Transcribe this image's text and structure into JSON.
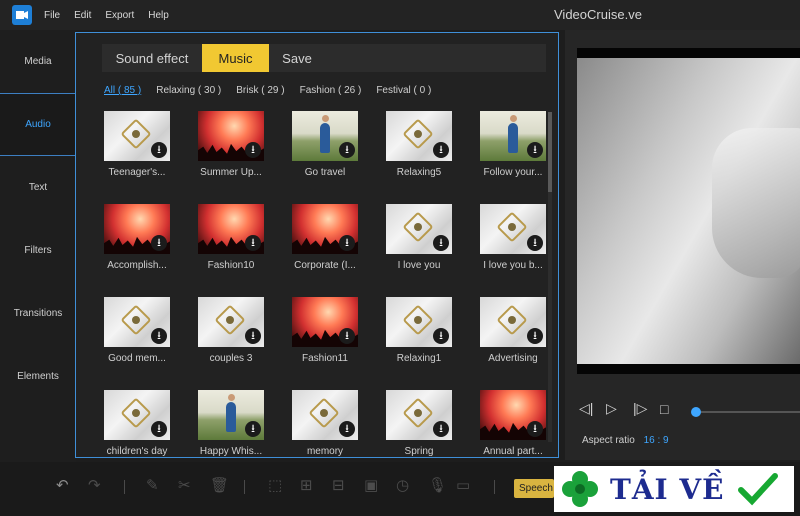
{
  "app": {
    "title": "VideoCruise.ve",
    "menu": [
      "File",
      "Edit",
      "Export",
      "Help"
    ]
  },
  "sidebar": {
    "items": [
      {
        "label": "Media",
        "active": false
      },
      {
        "label": "Audio",
        "active": true
      },
      {
        "label": "Text",
        "active": false
      },
      {
        "label": "Filters",
        "active": false
      },
      {
        "label": "Transitions",
        "active": false
      },
      {
        "label": "Elements",
        "active": false
      }
    ]
  },
  "library": {
    "tabs": [
      {
        "label": "Sound effect"
      },
      {
        "label": "Music",
        "selected": true
      },
      {
        "label": "Save"
      }
    ],
    "categories": [
      {
        "label": "All ( 85 )",
        "selected": true
      },
      {
        "label": "Relaxing ( 30 )"
      },
      {
        "label": "Brisk ( 29 )"
      },
      {
        "label": "Fashion ( 26 )"
      },
      {
        "label": "Festival ( 0 )"
      }
    ],
    "tracks": [
      {
        "label": "Teenager's...",
        "thumb": "paper"
      },
      {
        "label": "Summer Up...",
        "thumb": "concert"
      },
      {
        "label": "Go travel",
        "thumb": "field"
      },
      {
        "label": "Relaxing5",
        "thumb": "paper"
      },
      {
        "label": "Follow your...",
        "thumb": "field"
      },
      {
        "label": "Accomplish...",
        "thumb": "concert"
      },
      {
        "label": "Fashion10",
        "thumb": "concert"
      },
      {
        "label": "Corporate (I...",
        "thumb": "concert"
      },
      {
        "label": "I love you",
        "thumb": "paper"
      },
      {
        "label": "I love you b...",
        "thumb": "paper"
      },
      {
        "label": "Good mem...",
        "thumb": "paper"
      },
      {
        "label": "couples 3",
        "thumb": "paper"
      },
      {
        "label": "Fashion11",
        "thumb": "concert"
      },
      {
        "label": "Relaxing1",
        "thumb": "paper"
      },
      {
        "label": "Advertising",
        "thumb": "paper"
      },
      {
        "label": "children's day",
        "thumb": "paper"
      },
      {
        "label": "Happy Whis...",
        "thumb": "field"
      },
      {
        "label": "memory",
        "thumb": "paper"
      },
      {
        "label": "Spring",
        "thumb": "paper"
      },
      {
        "label": "Annual part...",
        "thumb": "concert"
      }
    ]
  },
  "preview": {
    "aspect_label": "Aspect ratio",
    "aspect_value": "16 : 9",
    "progress": 0.0
  },
  "toolbar": {
    "speech_label": "Speech"
  },
  "watermark": {
    "text": "TẢI VỀ"
  },
  "colors": {
    "accent": "#3ea6ff",
    "highlight": "#f1c832",
    "panel_border": "#3f8fd8"
  }
}
